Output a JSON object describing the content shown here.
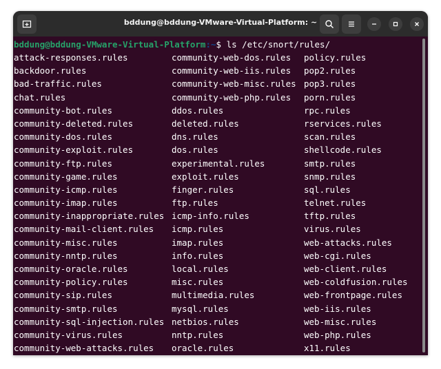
{
  "window": {
    "title": "bddung@bddung-VMware-Virtual-Platform: ~"
  },
  "titlebar": {
    "new_tab_icon": "new-tab-icon",
    "search_icon": "search-icon",
    "menu_icon": "hamburger-menu-icon",
    "minimize_icon": "minimize-icon",
    "maximize_icon": "maximize-icon",
    "close_icon": "close-icon"
  },
  "terminal": {
    "prompt_user": "bddung@bddung-VMware-Virtual-Platform",
    "prompt_path": ":~",
    "prompt_symbol": "$ ",
    "command": "ls /etc/snort/rules/",
    "colors": {
      "background": "#300a24",
      "text": "#ffffff",
      "prompt_user": "#26a269",
      "prompt_path": "#12488b"
    },
    "rows": [
      [
        "attack-responses.rules",
        "community-web-dos.rules",
        "policy.rules"
      ],
      [
        "backdoor.rules",
        "community-web-iis.rules",
        "pop2.rules"
      ],
      [
        "bad-traffic.rules",
        "community-web-misc.rules",
        "pop3.rules"
      ],
      [
        "chat.rules",
        "community-web-php.rules",
        "porn.rules"
      ],
      [
        "community-bot.rules",
        "ddos.rules",
        "rpc.rules"
      ],
      [
        "community-deleted.rules",
        "deleted.rules",
        "rservices.rules"
      ],
      [
        "community-dos.rules",
        "dns.rules",
        "scan.rules"
      ],
      [
        "community-exploit.rules",
        "dos.rules",
        "shellcode.rules"
      ],
      [
        "community-ftp.rules",
        "experimental.rules",
        "smtp.rules"
      ],
      [
        "community-game.rules",
        "exploit.rules",
        "snmp.rules"
      ],
      [
        "community-icmp.rules",
        "finger.rules",
        "sql.rules"
      ],
      [
        "community-imap.rules",
        "ftp.rules",
        "telnet.rules"
      ],
      [
        "community-inappropriate.rules",
        "icmp-info.rules",
        "tftp.rules"
      ],
      [
        "community-mail-client.rules",
        "icmp.rules",
        "virus.rules"
      ],
      [
        "community-misc.rules",
        "imap.rules",
        "web-attacks.rules"
      ],
      [
        "community-nntp.rules",
        "info.rules",
        "web-cgi.rules"
      ],
      [
        "community-oracle.rules",
        "local.rules",
        "web-client.rules"
      ],
      [
        "community-policy.rules",
        "misc.rules",
        "web-coldfusion.rules"
      ],
      [
        "community-sip.rules",
        "multimedia.rules",
        "web-frontpage.rules"
      ],
      [
        "community-smtp.rules",
        "mysql.rules",
        "web-iis.rules"
      ],
      [
        "community-sql-injection.rules",
        "netbios.rules",
        "web-misc.rules"
      ],
      [
        "community-virus.rules",
        "nntp.rules",
        "web-php.rules"
      ],
      [
        "community-web-attacks.rules",
        "oracle.rules",
        "x11.rules"
      ]
    ]
  }
}
